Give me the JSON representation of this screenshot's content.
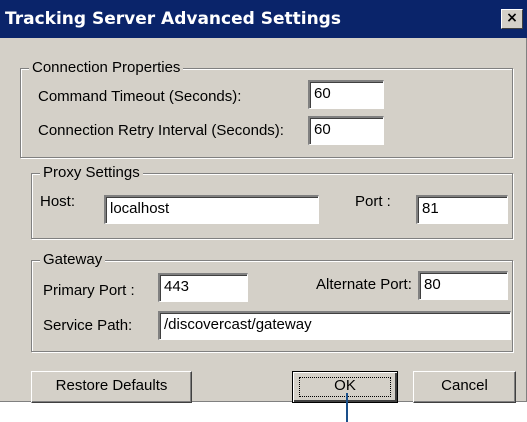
{
  "window": {
    "title": "Tracking Server Advanced Settings",
    "close_glyph": "×"
  },
  "connection": {
    "legend": "Connection Properties",
    "command_timeout_label": "Command Timeout (Seconds):",
    "command_timeout_value": "60",
    "retry_interval_label": "Connection Retry Interval (Seconds):",
    "retry_interval_value": "60"
  },
  "proxy": {
    "legend": "Proxy Settings",
    "host_label": "Host:",
    "host_value": "localhost",
    "port_label": "Port :",
    "port_value": "81"
  },
  "gateway": {
    "legend": "Gateway",
    "primary_port_label": "Primary Port :",
    "primary_port_value": "443",
    "alternate_port_label": "Alternate Port:",
    "alternate_port_value": "80",
    "service_path_label": "Service Path:",
    "service_path_value": "/discovercast/gateway"
  },
  "buttons": {
    "restore_defaults": "Restore Defaults",
    "ok": "OK",
    "cancel": "Cancel"
  }
}
